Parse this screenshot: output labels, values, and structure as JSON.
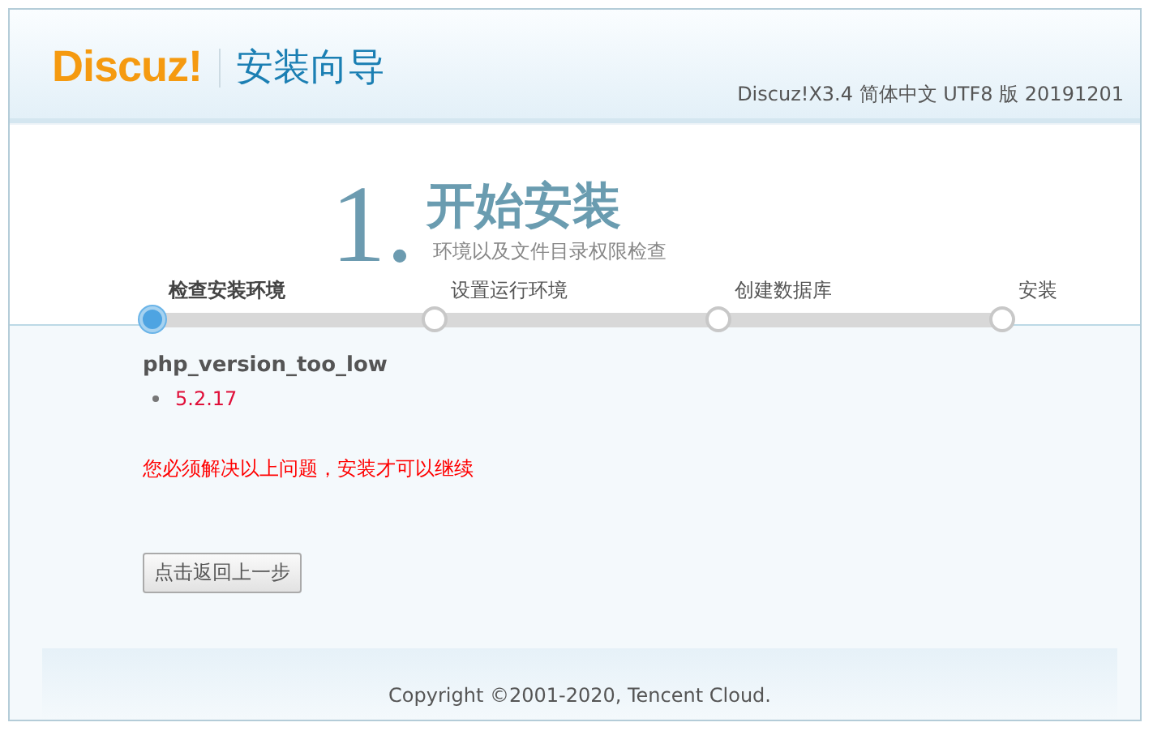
{
  "header": {
    "logo": "Discuz!",
    "title": "安装向导",
    "version": "Discuz!X3.4 简体中文 UTF8 版 20191201"
  },
  "step_banner": {
    "number": "1.",
    "title": "开始安装",
    "subtitle": "环境以及文件目录权限检查"
  },
  "steps": [
    {
      "label": "检查安装环境",
      "selected": true
    },
    {
      "label": "设置运行环境",
      "selected": false
    },
    {
      "label": "创建数据库",
      "selected": false
    },
    {
      "label": "安装",
      "selected": false
    }
  ],
  "error": {
    "title": "php_version_too_low",
    "items": [
      "5.2.17"
    ],
    "message": "您必须解决以上问题，安装才可以继续"
  },
  "back_button": "点击返回上一步",
  "footer": "Copyright ©2001-2020, Tencent Cloud."
}
